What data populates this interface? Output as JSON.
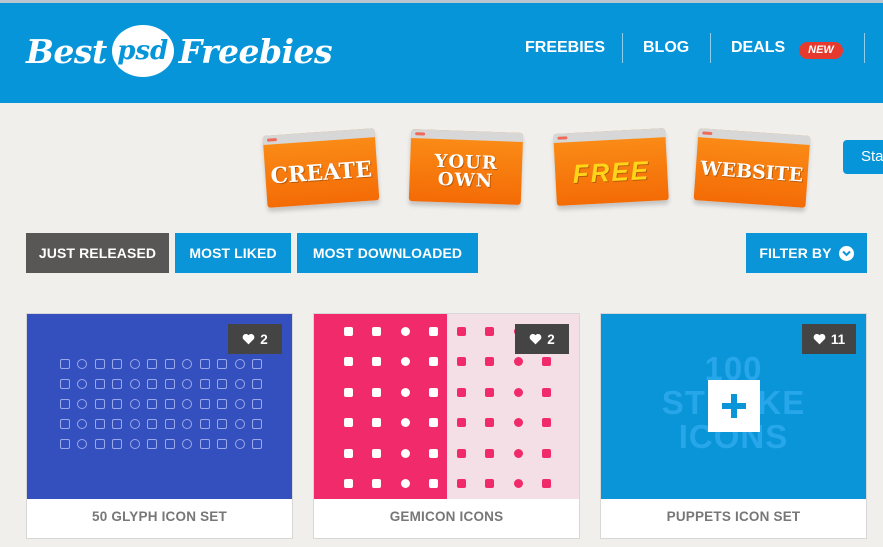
{
  "site": {
    "logo": {
      "part1": "Best",
      "badge": "psd",
      "part2": "Freebies"
    }
  },
  "nav": {
    "items": [
      "FREEBIES",
      "BLOG",
      "DEALS"
    ],
    "new_badge": "NEW"
  },
  "banner": {
    "cards": [
      "CREATE",
      "YOUR OWN",
      "FREE",
      "WEBSITE"
    ],
    "start_button": "Sta"
  },
  "filters": {
    "just_released": "JUST RELEASED",
    "most_liked": "MOST LIKED",
    "most_downloaded": "MOST DOWNLOADED",
    "filter_by": "FILTER BY"
  },
  "cards": [
    {
      "title": "50 GLYPH ICON SET",
      "likes": "2",
      "color": "#3450be"
    },
    {
      "title": "GEMICON ICONS",
      "likes": "2",
      "color": "#f02a6b"
    },
    {
      "title": "PUPPETS ICON SET",
      "likes": "11",
      "color": "#0a95d9",
      "overlay_line1": "100",
      "overlay_line2": "STROKE",
      "overlay_line3": "ICONS"
    }
  ],
  "colors": {
    "header_blue": "#0795d9",
    "banner_orange": "#f57c0b",
    "dark_button": "#595755",
    "new_badge_red": "#e63a2f"
  }
}
